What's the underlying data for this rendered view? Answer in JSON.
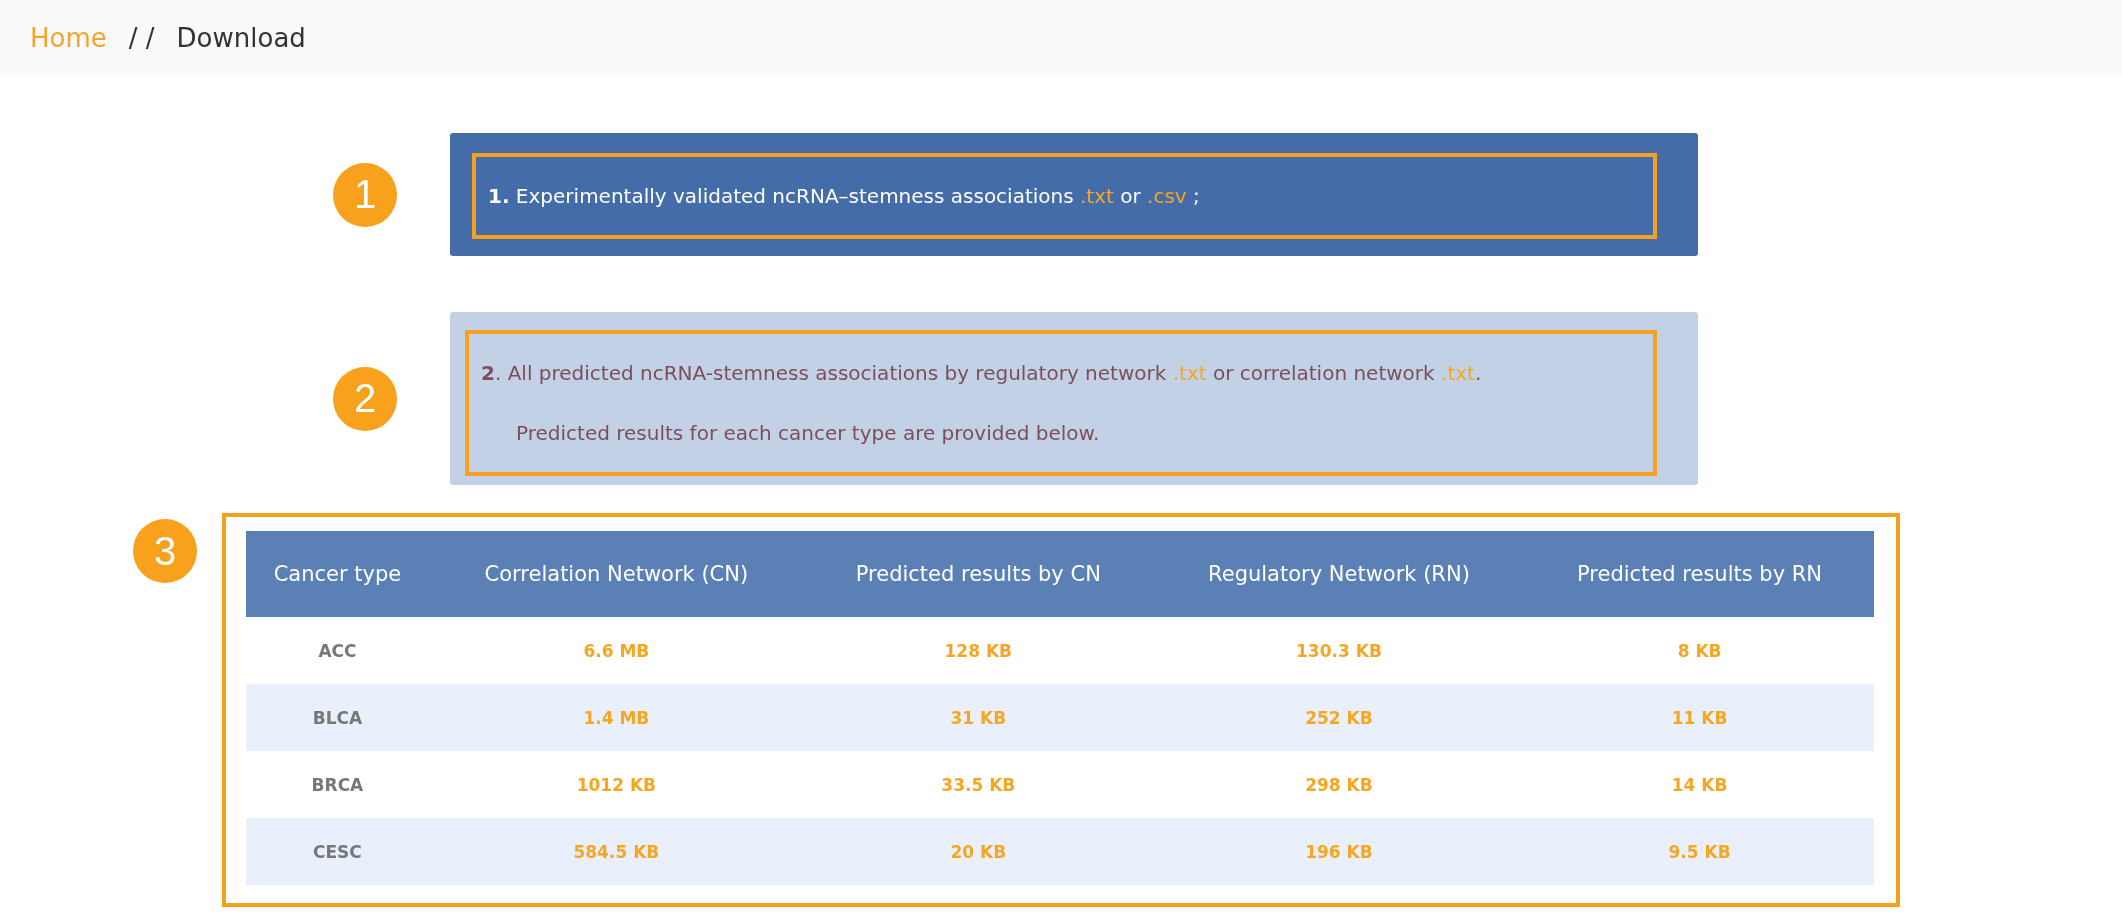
{
  "breadcrumb": [
    {
      "label": "Home",
      "kind": "link"
    },
    {
      "label": "/ /",
      "kind": "separator"
    },
    {
      "label": "Download",
      "kind": "current"
    }
  ],
  "sections": [
    {
      "number": "1",
      "paragraphs": [
        [
          {
            "kind": "bold",
            "text": "1."
          },
          {
            "kind": "text",
            "text": " Experimentally validated ncRNA–stemness associations "
          },
          {
            "kind": "link",
            "text": ".txt"
          },
          {
            "kind": "text",
            "text": " or "
          },
          {
            "kind": "link",
            "text": ".csv"
          },
          {
            "kind": "text",
            "text": " ;"
          }
        ]
      ]
    },
    {
      "number": "2",
      "paragraphs": [
        [
          {
            "kind": "bold",
            "text": "2"
          },
          {
            "kind": "text",
            "text": ". All predicted ncRNA-stemness associations by regulatory network "
          },
          {
            "kind": "link",
            "text": ".txt"
          },
          {
            "kind": "text",
            "text": " or correlation network "
          },
          {
            "kind": "link",
            "text": ".txt"
          },
          {
            "kind": "text",
            "text": "."
          }
        ],
        [
          {
            "kind": "text",
            "text": "Predicted results for each cancer type are provided below."
          }
        ]
      ]
    }
  ],
  "table": {
    "number": "3",
    "columns": [
      "Cancer type",
      "Correlation Network (CN)",
      "Predicted results by CN",
      "Regulatory Network (RN)",
      "Predicted results by RN"
    ],
    "rows": [
      [
        "ACC",
        "6.6 MB",
        "128 KB",
        "130.3 KB",
        "8 KB"
      ],
      [
        "BLCA",
        "1.4 MB",
        "31 KB",
        "252 KB",
        "11 KB"
      ],
      [
        "BRCA",
        "1012 KB",
        "33.5 KB",
        "298 KB",
        "14 KB"
      ],
      [
        "CESC",
        "584.5 KB",
        "20 KB",
        "196 KB",
        "9.5 KB"
      ]
    ]
  }
}
